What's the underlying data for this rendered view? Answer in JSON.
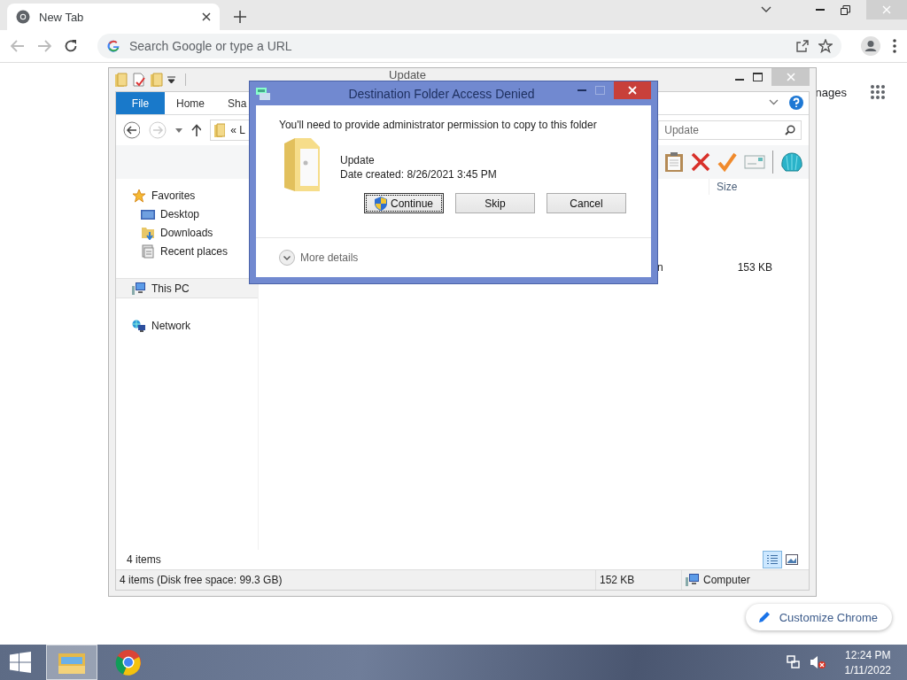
{
  "browser": {
    "tab": {
      "title": "New Tab"
    },
    "omnibox": {
      "placeholder": "Search Google or type a URL"
    },
    "page": {
      "images_link": "nages",
      "customize_button": "Customize Chrome"
    }
  },
  "explorer": {
    "title": "Update",
    "ribbon_tabs": [
      {
        "label": "File",
        "selected": true
      },
      {
        "label": "Home",
        "selected": false
      },
      {
        "label": "Sha",
        "selected": false
      }
    ],
    "address": "«  L",
    "search": {
      "value": "Update"
    },
    "columns": [
      {
        "label": "Size"
      }
    ],
    "rows": [
      {
        "column_1": "n",
        "size": "153 KB"
      }
    ],
    "nav": [
      {
        "label": "Favorites",
        "kind": "favorites",
        "selected": false,
        "children": [
          {
            "label": "Desktop",
            "kind": "desktop",
            "selected": false
          },
          {
            "label": "Downloads",
            "kind": "downloads",
            "selected": false
          },
          {
            "label": "Recent places",
            "kind": "recent",
            "selected": false
          }
        ]
      },
      {
        "label": "This PC",
        "kind": "pc",
        "selected": true
      },
      {
        "label": "Network",
        "kind": "network",
        "selected": false
      }
    ],
    "item_count": "4 items",
    "views": [
      {
        "kind": "details",
        "selected": true
      },
      {
        "kind": "large",
        "selected": false
      }
    ],
    "status_bar": {
      "summary": "4 items (Disk free space: 99.3 GB)",
      "size": "152 KB",
      "location": "Computer"
    }
  },
  "dialog": {
    "title": "Destination Folder Access Denied",
    "message": "You'll need to provide administrator permission to copy to this folder",
    "item": {
      "name": "Update",
      "detail": "Date created: 8/26/2021 3:45 PM"
    },
    "buttons": [
      {
        "label": "Continue",
        "kind": "elevated",
        "focused": true
      },
      {
        "label": "Skip",
        "kind": "plain",
        "focused": false
      },
      {
        "label": "Cancel",
        "kind": "plain",
        "focused": false
      }
    ],
    "more_details": "More details"
  },
  "taskbar": {
    "apps": [
      {
        "kind": "explorer",
        "active": true
      },
      {
        "kind": "chrome",
        "active": false
      }
    ],
    "time": "12:24 PM",
    "date": "1/11/2022"
  }
}
